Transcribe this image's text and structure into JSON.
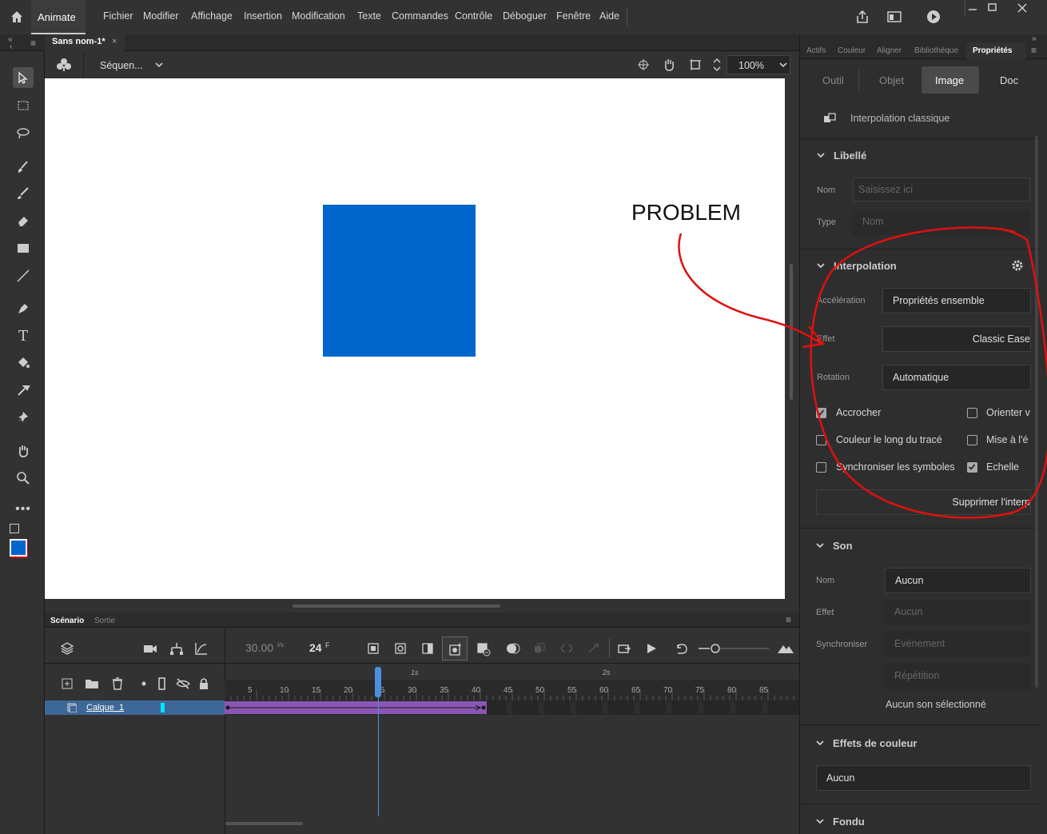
{
  "app": {
    "name": "Animate"
  },
  "menu": [
    "Fichier",
    "Modifier",
    "Affichage",
    "Insertion",
    "Modification",
    "Texte",
    "Commandes",
    "Contrôle",
    "Déboguer",
    "Fenêtre",
    "Aide"
  ],
  "document_tab": {
    "title": "Sans nom-1*",
    "close": "×"
  },
  "stage_toolbar": {
    "scene": "Séquen...",
    "zoom": "100%"
  },
  "annotation": {
    "text": "PROBLEM",
    "color": "#e01010"
  },
  "timeline": {
    "tabs": [
      "Scénario",
      "Sortie"
    ],
    "fps": "30.00",
    "fps_unit": "i/s",
    "frame": "24",
    "frame_unit": "F",
    "ticks": [
      "5",
      "10",
      "15",
      "20",
      "25",
      "30",
      "35",
      "40",
      "45",
      "50",
      "55",
      "60",
      "65",
      "70",
      "75",
      "80",
      "85"
    ],
    "seconds": [
      "1s",
      "2s"
    ],
    "layer_name": "Calque_1",
    "tween_color": "#8b56b4",
    "playhead_frame": 24
  },
  "properties": {
    "panel_tabs": [
      "Actifs",
      "Couleur",
      "Aligner",
      "Bibliothèque",
      "Propriétés"
    ],
    "subtabs": [
      "Outil",
      "Objet",
      "Image",
      "Doc"
    ],
    "active_subtab": "Image",
    "tween_type": "Interpolation classique",
    "libelle": {
      "title": "Libellé",
      "nom_label": "Nom",
      "nom_placeholder": "Saisissez ici",
      "type_label": "Type",
      "type_value": "Nom"
    },
    "interpolation": {
      "title": "Interpolation",
      "acceleration_label": "Accélération",
      "acceleration_value": "Propriétés ensemble",
      "effet_label": "Effet",
      "effet_value": "Classic Ease",
      "rotation_label": "Rotation",
      "rotation_value": "Automatique",
      "checkboxes": [
        {
          "label": "Accrocher",
          "checked": true
        },
        {
          "label": "Orienter v",
          "checked": false
        },
        {
          "label": "Couleur le long du tracé",
          "checked": false
        },
        {
          "label": "Mise à l'é",
          "checked": false
        },
        {
          "label": "Synchroniser les symboles",
          "checked": false
        },
        {
          "label": "Echelle",
          "checked": true
        }
      ],
      "delete_button": "Supprimer l'interp"
    },
    "son": {
      "title": "Son",
      "nom_label": "Nom",
      "nom_value": "Aucun",
      "effet_label": "Effet",
      "effet_value": "Aucun",
      "sync_label": "Synchroniser",
      "sync_value": "Evénement",
      "repeat_value": "Répétition",
      "status": "Aucun son sélectionné"
    },
    "color_effects": {
      "title": "Effets de couleur",
      "value": "Aucun"
    },
    "fondu": {
      "title": "Fondu"
    }
  },
  "colors": {
    "fill": "#0066cc",
    "stroke": "#cc0000",
    "accent": "#4a90e2"
  }
}
